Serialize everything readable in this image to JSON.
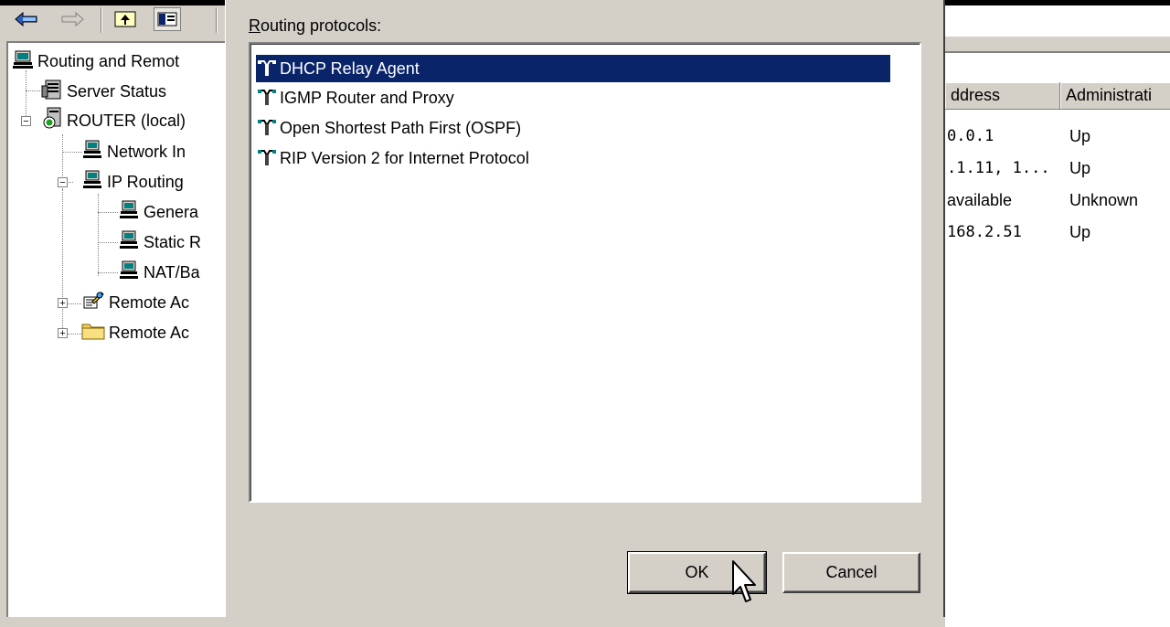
{
  "tree": {
    "items": [
      {
        "label": "Routing and Remot",
        "icon": "server-computer-icon"
      },
      {
        "label": "Server Status",
        "icon": "server-status-icon"
      },
      {
        "label": "ROUTER (local)",
        "icon": "router-server-icon"
      },
      {
        "label": "Network In",
        "icon": "network-interfaces-icon"
      },
      {
        "label": "IP Routing",
        "icon": "ip-routing-icon"
      },
      {
        "label": "Genera",
        "icon": "general-icon"
      },
      {
        "label": "Static R",
        "icon": "static-routes-icon"
      },
      {
        "label": "NAT/Ba",
        "icon": "nat-icon"
      },
      {
        "label": "Remote Ac",
        "icon": "remote-access-policies-icon"
      },
      {
        "label": "Remote Ac",
        "icon": "remote-access-logging-icon"
      }
    ]
  },
  "dialog": {
    "label_prefix": "R",
    "label_rest": "outing protocols:",
    "protocols": [
      {
        "label": "DHCP Relay Agent",
        "selected": true
      },
      {
        "label": "IGMP Router and Proxy",
        "selected": false
      },
      {
        "label": "Open Shortest Path First (OSPF)",
        "selected": false
      },
      {
        "label": "RIP Version 2 for Internet Protocol",
        "selected": false
      }
    ],
    "ok_label": "OK",
    "cancel_label": "Cancel"
  },
  "list": {
    "columns": [
      "ddress",
      "Administrati"
    ],
    "rows": [
      [
        "0.0.1",
        "Up"
      ],
      [
        ".1.11, 1...",
        "Up"
      ],
      [
        "available",
        "Unknown"
      ],
      [
        "168.2.51",
        "Up"
      ]
    ]
  },
  "colors": {
    "selection": "#0a246a",
    "face": "#d4d0c8"
  }
}
